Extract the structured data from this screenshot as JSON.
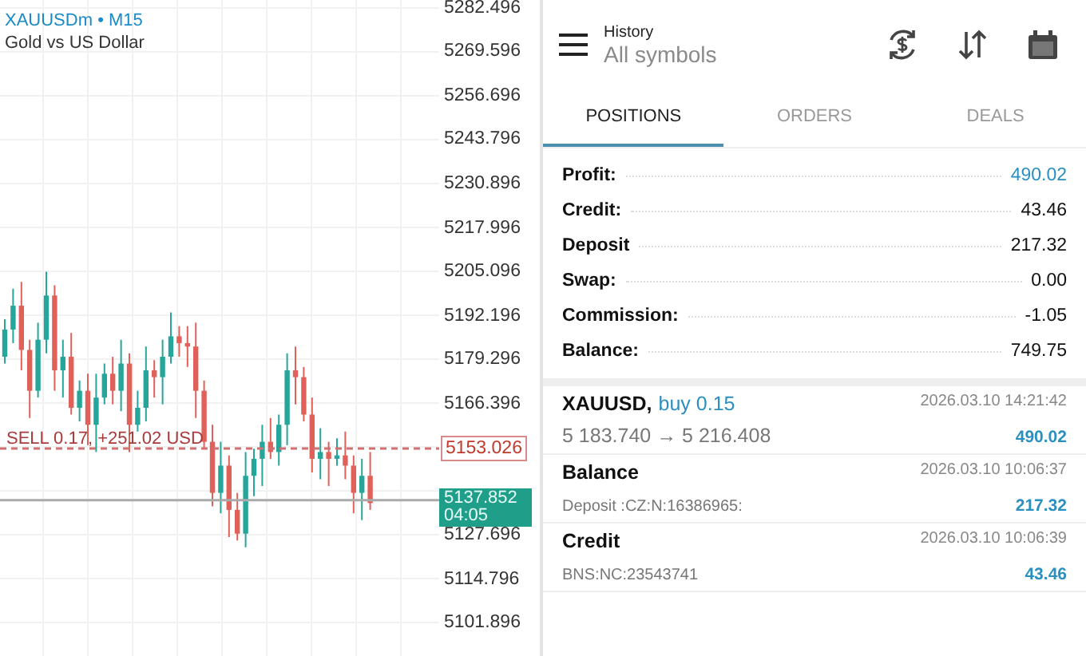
{
  "chart": {
    "symbol": "XAUUSDm",
    "separator": "•",
    "timeframe": "M15",
    "chart_data": {
      "type": "candlestick",
      "grid": true,
      "ref_lines": [
        {
          "axis": "y",
          "value": 5153.026,
          "label": "5153.026",
          "color": "#d07070"
        },
        {
          "axis": "y",
          "value": 5137.852,
          "label": "5137.852",
          "color": "#aaaaaa"
        }
      ],
      "ylim": [
        5092.05,
        5284.84
      ],
      "yticks": [
        {
          "value": 5282.496,
          "label": "5282.496"
        },
        {
          "value": 5269.596,
          "label": "5269.596"
        },
        {
          "value": 5256.696,
          "label": "5256.696"
        },
        {
          "value": 5243.796,
          "label": "5243.796"
        },
        {
          "value": 5230.896,
          "label": "5230.896"
        },
        {
          "value": 5217.996,
          "label": "5217.996"
        },
        {
          "value": 5205.096,
          "label": "5205.096"
        },
        {
          "value": 5192.196,
          "label": "5192.196"
        },
        {
          "value": 5179.296,
          "label": "5179.296"
        },
        {
          "value": 5166.396,
          "label": "5166.396"
        },
        {
          "value": 5127.696,
          "label": "5127.696"
        },
        {
          "value": 5114.796,
          "label": "5114.796"
        },
        {
          "value": 5101.896,
          "label": "5101.896"
        }
      ],
      "ohlc": [
        [
          5180,
          5191,
          5178,
          5188
        ],
        [
          5188,
          5200,
          5184,
          5195
        ],
        [
          5195,
          5202,
          5176,
          5182
        ],
        [
          5182,
          5185,
          5162,
          5170
        ],
        [
          5170,
          5190,
          5168,
          5185
        ],
        [
          5185,
          5205,
          5181,
          5198
        ],
        [
          5198,
          5201,
          5170,
          5176
        ],
        [
          5176,
          5185,
          5168,
          5180
        ],
        [
          5180,
          5187,
          5163,
          5165
        ],
        [
          5165,
          5173,
          5161,
          5170
        ],
        [
          5170,
          5175,
          5154,
          5160
        ],
        [
          5160,
          5175,
          5152,
          5168
        ],
        [
          5168,
          5178,
          5166,
          5175
        ],
        [
          5175,
          5180,
          5166,
          5170
        ],
        [
          5170,
          5185,
          5164,
          5178
        ],
        [
          5178,
          5181,
          5152,
          5160
        ],
        [
          5160,
          5170,
          5158,
          5165
        ],
        [
          5165,
          5183,
          5161,
          5176
        ],
        [
          5176,
          5179,
          5168,
          5174
        ],
        [
          5174,
          5185,
          5166,
          5180
        ],
        [
          5180,
          5193,
          5178,
          5186
        ],
        [
          5186,
          5189,
          5180,
          5184
        ],
        [
          5184,
          5189,
          5177,
          5183
        ],
        [
          5183,
          5190,
          5162,
          5170
        ],
        [
          5170,
          5173,
          5153,
          5155
        ],
        [
          5155,
          5160,
          5136,
          5140
        ],
        [
          5140,
          5155,
          5134,
          5148
        ],
        [
          5148,
          5151,
          5127,
          5135
        ],
        [
          5135,
          5140,
          5126,
          5128
        ],
        [
          5128,
          5152,
          5124,
          5145
        ],
        [
          5145,
          5153,
          5139,
          5150
        ],
        [
          5150,
          5160,
          5142,
          5155
        ],
        [
          5155,
          5162,
          5150,
          5152
        ],
        [
          5152,
          5163,
          5148,
          5160
        ],
        [
          5160,
          5181,
          5154,
          5176
        ],
        [
          5176,
          5183,
          5166,
          5174
        ],
        [
          5174,
          5177,
          5161,
          5163
        ],
        [
          5163,
          5168,
          5146,
          5150
        ],
        [
          5150,
          5159,
          5144,
          5152
        ],
        [
          5152,
          5155,
          5142,
          5150
        ],
        [
          5150,
          5156,
          5148,
          5151
        ],
        [
          5151,
          5158,
          5144,
          5148
        ],
        [
          5148,
          5151,
          5134,
          5140
        ],
        [
          5140,
          5150,
          5132,
          5145
        ],
        [
          5145,
          5152,
          5135,
          5137
        ]
      ]
    },
    "description": "Gold vs US Dollar",
    "order_label": "SELL 0.17,  +251.02 USD",
    "countdown": "04:05"
  },
  "header": {
    "title": "History",
    "subtitle": "All symbols"
  },
  "tabs": [
    {
      "label": "POSITIONS",
      "selected": true
    },
    {
      "label": "ORDERS",
      "selected": false
    },
    {
      "label": "DEALS",
      "selected": false
    }
  ],
  "summary": [
    {
      "label": "Profit:",
      "value": "490.02",
      "highlight": true
    },
    {
      "label": "Credit:",
      "value": "43.46",
      "highlight": false
    },
    {
      "label": "Deposit",
      "value": "217.32",
      "highlight": false
    },
    {
      "label": "Swap:",
      "value": "0.00",
      "highlight": false
    },
    {
      "label": "Commission:",
      "value": "-1.05",
      "highlight": false
    },
    {
      "label": "Balance:",
      "value": "749.75",
      "highlight": false
    }
  ],
  "deals": [
    {
      "kind": "trade",
      "title": "XAUUSD,",
      "side": "buy 0.15",
      "detail": "5 183.740 → 5 216.408",
      "time": "2026.03.10 14:21:42",
      "amount": "490.02"
    },
    {
      "kind": "operation",
      "title": "Balance",
      "detail": "Deposit :CZ:N:16386965:",
      "time": "2026.03.10 10:06:37",
      "amount": "217.32"
    },
    {
      "kind": "operation",
      "title": "Credit",
      "detail": "BNS:NC:23543741",
      "time": "2026.03.10 10:06:39",
      "amount": "43.46"
    }
  ]
}
